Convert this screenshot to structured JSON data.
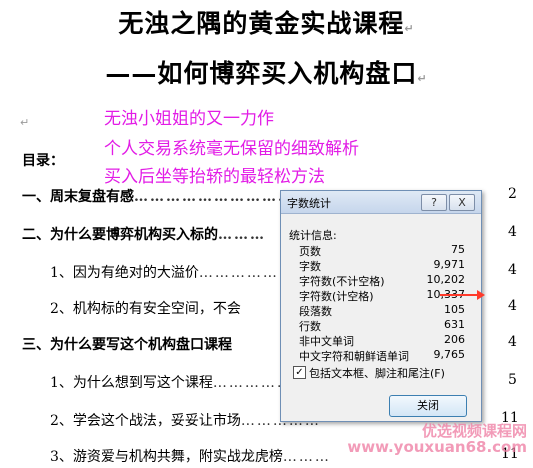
{
  "doc": {
    "title1": "无浊之隅的黄金实战课程",
    "title2": "——如何博弈买入机构盘口",
    "para_mark": "↵",
    "taglines": [
      "无浊小姐姐的又一力作",
      "个人交易系统毫无保留的细致解析",
      "买入后坐等抬轿的最轻松方法"
    ],
    "toc_heading": "目录：",
    "toc": [
      {
        "text": "一、周末复盘有感",
        "page": "2"
      },
      {
        "text": "二、为什么要博弈机构买入标的",
        "page": "4"
      },
      {
        "text": "1、因为有绝对的大溢价",
        "page": "4"
      },
      {
        "text": "2、机构标的有安全空间，不会",
        "page": "4"
      },
      {
        "text": "三、为什么要写这个机构盘口课程",
        "page": "4"
      },
      {
        "text": "1、为什么想到写这个课程",
        "page": "5"
      },
      {
        "text": "2、学会这个战法，妥妥让市场",
        "page": "11"
      },
      {
        "text": "3、游资爱与机构共舞，附实战龙虎榜",
        "page": "11"
      }
    ]
  },
  "dialog": {
    "title": "字数统计",
    "help_label": "?",
    "close_x": "X",
    "section_label": "统计信息:",
    "stats": [
      {
        "label": "页数",
        "value": "75"
      },
      {
        "label": "字数",
        "value": "9,971"
      },
      {
        "label": "字符数(不计空格)",
        "value": "10,202"
      },
      {
        "label": "字符数(计空格)",
        "value": "10,337"
      },
      {
        "label": "段落数",
        "value": "105"
      },
      {
        "label": "行数",
        "value": "631"
      },
      {
        "label": "非中文单词",
        "value": "206"
      },
      {
        "label": "中文字符和朝鲜语单词",
        "value": "9,765"
      }
    ],
    "checkbox_label": "包括文本框、脚注和尾注(F)",
    "checkbox_checked": "✓",
    "close_button": "关闭"
  },
  "watermark": {
    "line1": "优选视频课程网",
    "line2": "www.youxuan68.com"
  }
}
